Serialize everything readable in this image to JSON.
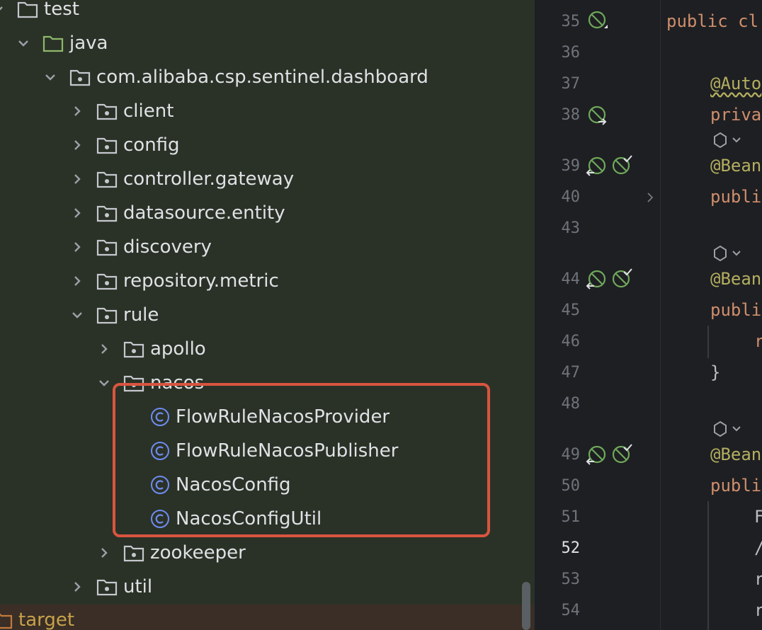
{
  "project_tree": {
    "items": [
      {
        "label": "test",
        "expanded": true
      },
      {
        "label": "java",
        "expanded": true
      },
      {
        "label": "com.alibaba.csp.sentinel.dashboard",
        "expanded": true
      },
      {
        "label": "client",
        "expanded": false
      },
      {
        "label": "config",
        "expanded": false
      },
      {
        "label": "controller.gateway",
        "expanded": false
      },
      {
        "label": "datasource.entity",
        "expanded": false
      },
      {
        "label": "discovery",
        "expanded": false
      },
      {
        "label": "repository.metric",
        "expanded": false
      },
      {
        "label": "rule",
        "expanded": true
      },
      {
        "label": "apollo",
        "expanded": false
      },
      {
        "label": "nacos",
        "expanded": true
      },
      {
        "label": "FlowRuleNacosProvider"
      },
      {
        "label": "FlowRuleNacosPublisher"
      },
      {
        "label": "NacosConfig"
      },
      {
        "label": "NacosConfigUtil"
      },
      {
        "label": "zookeeper",
        "expanded": false
      },
      {
        "label": "util",
        "expanded": false
      },
      {
        "label": "target"
      }
    ]
  },
  "editor": {
    "line_numbers": [
      "35",
      "36",
      "37",
      "38",
      "",
      "39",
      "40",
      "43",
      "",
      "44",
      "45",
      "46",
      "47",
      "48",
      "",
      "49",
      "50",
      "51",
      "52",
      "53",
      "54"
    ],
    "current_line": "52",
    "code": {
      "l35": "public cl",
      "l37": "@Auto",
      "l38": "priva",
      "l39": "@Bean",
      "l40": "publi",
      "l44": "@Bean",
      "l45": "publi",
      "l46": "r",
      "l47": "}",
      "l49": "@Bean",
      "l50": "publi",
      "l51": "F",
      "l52": "/",
      "l53": "r",
      "l54": "r"
    }
  },
  "colors": {
    "tree_bg": "#2a3227",
    "highlight_border": "#d9553f",
    "keyword": "#cf8e6d",
    "annotation": "#b3ae60",
    "class_icon": "#6f8bf0"
  },
  "icons": {
    "expanded_chevron": "chevron-down-icon",
    "collapsed_chevron": "chevron-right-icon",
    "folder": "folder-icon",
    "package": "package-icon",
    "class": "class-icon",
    "bean": "spring-bean-icon",
    "lightbulb": "lightbulb-icon"
  }
}
